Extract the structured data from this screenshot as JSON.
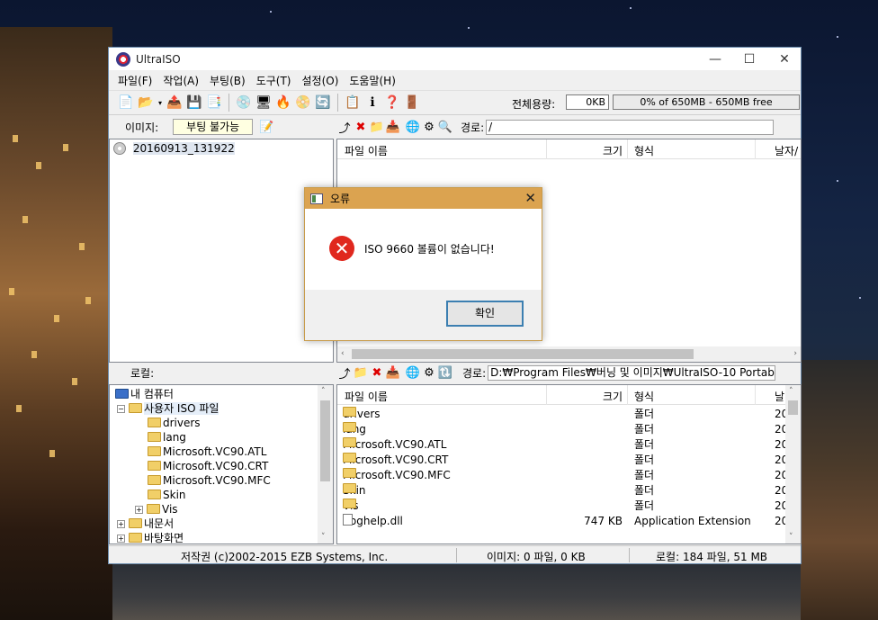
{
  "window": {
    "title": "UltraISO",
    "controls": {
      "minimize": "—",
      "maximize": "☐",
      "close": "✕"
    }
  },
  "menu": [
    "파일(F)",
    "작업(A)",
    "부팅(B)",
    "도구(T)",
    "설정(O)",
    "도움말(H)"
  ],
  "toolbar": {
    "size_label": "전체용량:",
    "size_value": "0KB",
    "capacity": "0% of 650MB - 650MB free"
  },
  "image_bar": {
    "label": "이미지:",
    "boot_status": "부팅 불가능"
  },
  "image_tree": {
    "root": "20160913_131922"
  },
  "iso_pane": {
    "path_label": "경로:",
    "path": "/",
    "columns": [
      "파일 이름",
      "크기",
      "형식",
      "날자/"
    ]
  },
  "local_bar": {
    "label": "로컬:"
  },
  "local_tree": {
    "items": [
      {
        "label": "내 컴퓨터",
        "toggle": ""
      },
      {
        "label": "사용자 ISO 파일",
        "toggle": "−"
      },
      {
        "label": "drivers",
        "toggle": ""
      },
      {
        "label": "lang",
        "toggle": ""
      },
      {
        "label": "Microsoft.VC90.ATL",
        "toggle": ""
      },
      {
        "label": "Microsoft.VC90.CRT",
        "toggle": ""
      },
      {
        "label": "Microsoft.VC90.MFC",
        "toggle": ""
      },
      {
        "label": "Skin",
        "toggle": ""
      },
      {
        "label": "Vis",
        "toggle": "+"
      },
      {
        "label": "내문서",
        "toggle": "+"
      },
      {
        "label": "바탕화면",
        "toggle": "+"
      }
    ]
  },
  "local_pane": {
    "path_label": "경로:",
    "path": "D:₩Program Files₩버닝 및 이미지₩UltraISO-10 Portable",
    "columns": [
      "파일 이름",
      "크기",
      "형식",
      "날"
    ],
    "rows": [
      {
        "name": "drivers",
        "size": "",
        "type": "폴더",
        "date": "20",
        "kind": "folder"
      },
      {
        "name": "lang",
        "size": "",
        "type": "폴더",
        "date": "20",
        "kind": "folder"
      },
      {
        "name": "Microsoft.VC90.ATL",
        "size": "",
        "type": "폴더",
        "date": "20",
        "kind": "folder"
      },
      {
        "name": "Microsoft.VC90.CRT",
        "size": "",
        "type": "폴더",
        "date": "20",
        "kind": "folder"
      },
      {
        "name": "Microsoft.VC90.MFC",
        "size": "",
        "type": "폴더",
        "date": "20",
        "kind": "folder"
      },
      {
        "name": "Skin",
        "size": "",
        "type": "폴더",
        "date": "20",
        "kind": "folder"
      },
      {
        "name": "Vis",
        "size": "",
        "type": "폴더",
        "date": "20",
        "kind": "folder"
      },
      {
        "name": "dbghelp.dll",
        "size": "747 KB",
        "type": "Application Extension",
        "date": "20",
        "kind": "file"
      }
    ]
  },
  "status": {
    "copyright": "저작권 (c)2002-2015 EZB Systems, Inc.",
    "image": "이미지: 0 파일, 0 KB",
    "local": "로컬: 184 파일, 51 MB"
  },
  "dialog": {
    "title": "오류",
    "close": "✕",
    "message": "ISO 9660 볼륨이 없습니다!",
    "ok_label": "확인"
  }
}
